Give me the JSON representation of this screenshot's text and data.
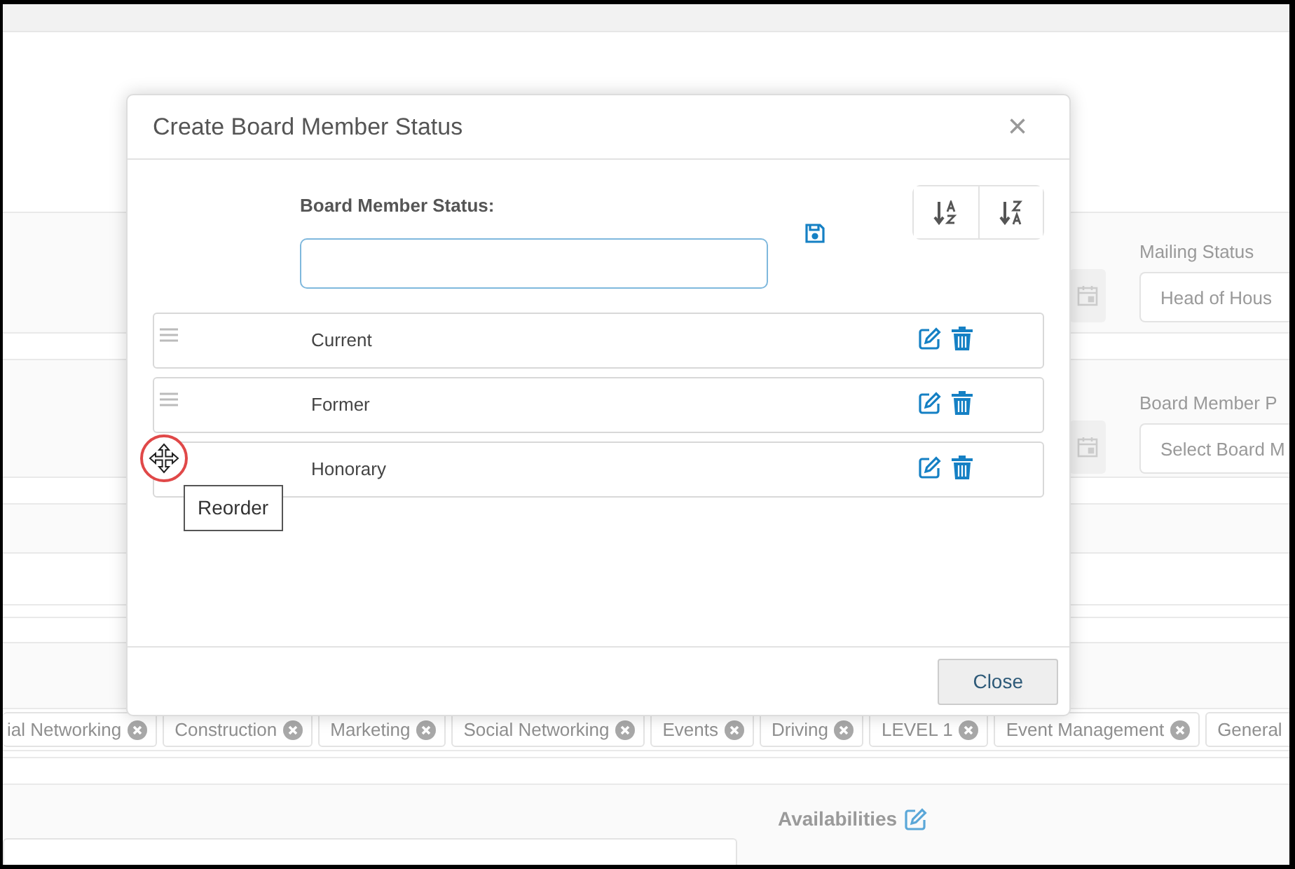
{
  "background": {
    "fields": [
      {
        "label": "Mailing Status",
        "value": "Head of Hous"
      },
      {
        "label": "Board Member P",
        "placeholder": "Select Board M"
      }
    ],
    "tags": [
      "ial Networking",
      "Construction",
      "Marketing",
      "Social Networking",
      "Events",
      "Driving",
      "LEVEL 1",
      "Event Management",
      "General"
    ],
    "availabilities_label": "Availabilities"
  },
  "modal": {
    "title": "Create Board Member Status",
    "close_symbol": "×",
    "field_label": "Board Member Status:",
    "items": [
      {
        "label": "Current",
        "hovered": false
      },
      {
        "label": "Former",
        "hovered": false
      },
      {
        "label": "Honorary",
        "hovered": true
      }
    ],
    "tooltip": "Reorder",
    "close_button": "Close"
  }
}
